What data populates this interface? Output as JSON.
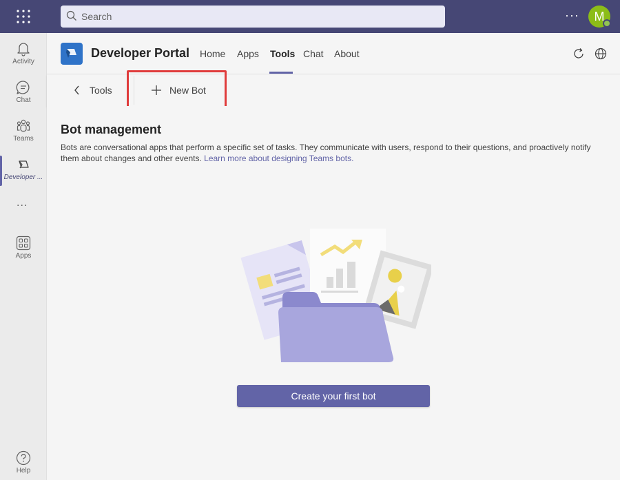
{
  "search": {
    "placeholder": "Search"
  },
  "user": {
    "initial": "M"
  },
  "rail": {
    "items": [
      {
        "label": "Activity"
      },
      {
        "label": "Chat"
      },
      {
        "label": "Teams"
      },
      {
        "label": "Developer ..."
      },
      {
        "label": "Apps"
      },
      {
        "label": "Help"
      }
    ],
    "more": "..."
  },
  "app": {
    "title": "Developer Portal",
    "tabs": [
      "Home",
      "Apps",
      "Tools",
      "Chat",
      "About"
    ],
    "active_tab": "Tools"
  },
  "subbar": {
    "back_label": "Tools",
    "new_bot_label": "New Bot"
  },
  "content": {
    "heading": "Bot management",
    "description": "Bots are conversational apps that perform a specific set of tasks. They communicate with users, respond to their questions, and proactively notify them about changes and other events.",
    "link_text": "Learn more about designing Teams bots.",
    "cta_label": "Create your first bot"
  },
  "colors": {
    "topbar": "#464775",
    "accent": "#6264a7",
    "highlight": "#e03c3c",
    "avatar": "#8cbd18"
  },
  "icons": [
    "waffle-icon",
    "search-icon",
    "more-icon",
    "bell-icon",
    "chat-icon",
    "teams-icon",
    "developer-portal-icon",
    "apps-icon",
    "help-icon",
    "refresh-icon",
    "globe-icon",
    "chevron-left-icon",
    "plus-icon"
  ]
}
